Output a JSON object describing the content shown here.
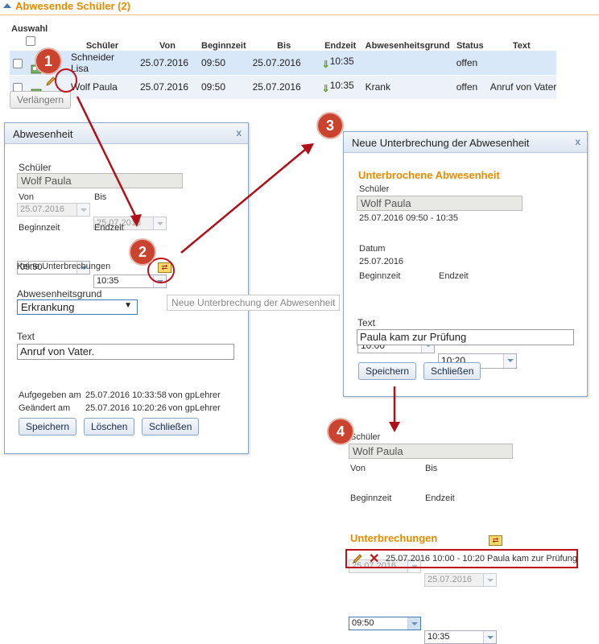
{
  "section": {
    "title": "Abwesende Schüler (2)"
  },
  "table": {
    "select_header": "Auswahl",
    "columns": [
      "Schüler",
      "Von",
      "Beginnzeit",
      "Bis",
      "Endzeit",
      "Abwesenheitsgrund",
      "Status",
      "Text"
    ],
    "rows": [
      {
        "student": "Schneider Lisa",
        "from": "25.07.2016",
        "start": "09:50",
        "to": "25.07.2016",
        "end": "10:35",
        "reason": "",
        "status": "offen",
        "text": ""
      },
      {
        "student": "Wolf Paula",
        "from": "25.07.2016",
        "start": "09:50",
        "to": "25.07.2016",
        "end": "10:35",
        "reason": "Krank",
        "status": "offen",
        "text": "Anruf von Vater"
      }
    ],
    "extend_button": "Verlängern"
  },
  "badges": [
    "1",
    "2",
    "3",
    "4"
  ],
  "dialog1": {
    "title": "Abwesenheit",
    "student_label": "Schüler",
    "student": "Wolf Paula",
    "from_label": "Von",
    "from": "25.07.2016",
    "to_label": "Bis",
    "to": "25.07.2016",
    "start_label": "Beginnzeit",
    "start": "09:50",
    "end_label": "Endzeit",
    "end": "10:35",
    "no_interruptions": "Keine Unterbrechungen",
    "reason_label": "Abwesenheitsgrund",
    "reason": "Erkrankung",
    "text_label": "Text",
    "text": "Anruf von Vater.",
    "submitted_label": "Aufgegeben am",
    "submitted": "25.07.2016 10:33:58",
    "submitted_by": "von gpLehrer",
    "changed_label": "Geändert am",
    "changed": "25.07.2016 10:20:26",
    "changed_by": "von gpLehrer",
    "save": "Speichern",
    "delete": "Löschen",
    "close": "Schließen"
  },
  "tooltip": "Neue Unterbrechung der Abwesenheit",
  "dialog2": {
    "title": "Neue Unterbrechung der Abwesenheit",
    "heading": "Unterbrochene Abwesenheit",
    "student_label": "Schüler",
    "student": "Wolf Paula",
    "range": "25.07.2016 09:50 - 10:35",
    "date_label": "Datum",
    "date": "25.07.2016",
    "start_label": "Beginnzeit",
    "start": "10:00",
    "end_label": "Endzeit",
    "end": "10:20",
    "text_label": "Text",
    "text": "Paula kam zur Prüfung",
    "save": "Speichern",
    "close": "Schließen"
  },
  "result": {
    "student_label": "Schüler",
    "student": "Wolf Paula",
    "from_label": "Von",
    "from": "25.07.2016",
    "to_label": "Bis",
    "to": "25.07.2016",
    "start_label": "Beginnzeit",
    "start": "09:50",
    "end_label": "Endzeit",
    "end": "10:35",
    "interruptions_heading": "Unterbrechungen",
    "interruption": "25.07.2016 10:00 - 10:20 Paula kam zur Prüfung"
  },
  "colors": {
    "accent_orange": "#e88a00",
    "annotation_red": "#c0101a",
    "row_selected": "#d9e8f8"
  }
}
